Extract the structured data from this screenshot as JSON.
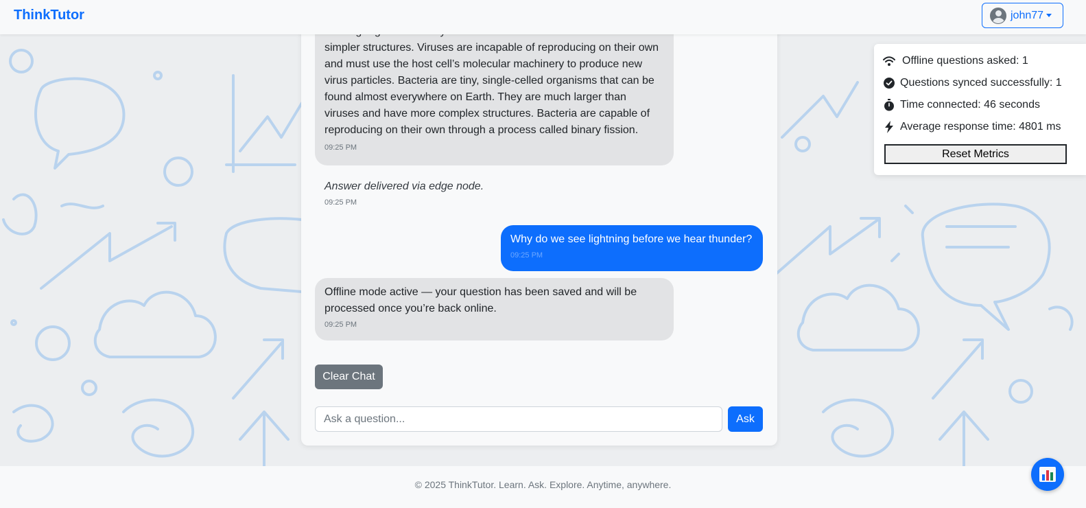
{
  "app": {
    "brand": "ThinkTutor"
  },
  "user": {
    "username": "john77"
  },
  "chat": {
    "messages": [
      {
        "role": "bot",
        "text": "of living organisms. They are much smaller than bacteria and have simpler structures. Viruses are incapable of reproducing on their own and must use the host cell’s molecular machinery to produce new virus particles. Bacteria are tiny, single-celled organisms that can be found almost everywhere on Earth. They are much larger than viruses and have more complex structures. Bacteria are capable of reproducing on their own through a process called binary fission.",
        "time": "09:25 PM"
      },
      {
        "role": "system",
        "text": "Answer delivered via edge node.",
        "time": "09:25 PM"
      },
      {
        "role": "user",
        "text": "Why do we see lightning before we hear thunder?",
        "time": "09:25 PM"
      },
      {
        "role": "bot",
        "text": "Offline mode active — your question has been saved and will be processed once you’re back online.",
        "time": "09:25 PM"
      }
    ],
    "clear_label": "Clear Chat",
    "input_placeholder": "Ask a question...",
    "ask_label": "Ask"
  },
  "metrics": {
    "offline_asked": "Offline questions asked: 1",
    "synced": "Questions synced successfully: 1",
    "time_connected": "Time connected: 46 seconds",
    "avg_response": "Average response time: 4801 ms",
    "reset_label": "Reset Metrics",
    "icons": [
      "wifi-icon",
      "check-circle-icon",
      "stopwatch-icon",
      "lightning-icon"
    ]
  },
  "footer": {
    "text": "© 2025 ThinkTutor. Learn. Ask. Explore. Anytime, anywhere."
  },
  "fab": {
    "icon": "bar-chart-icon"
  },
  "colors": {
    "primary": "#0d6efd",
    "secondary": "#6c757d",
    "bot_bubble": "#e2e3e5"
  }
}
